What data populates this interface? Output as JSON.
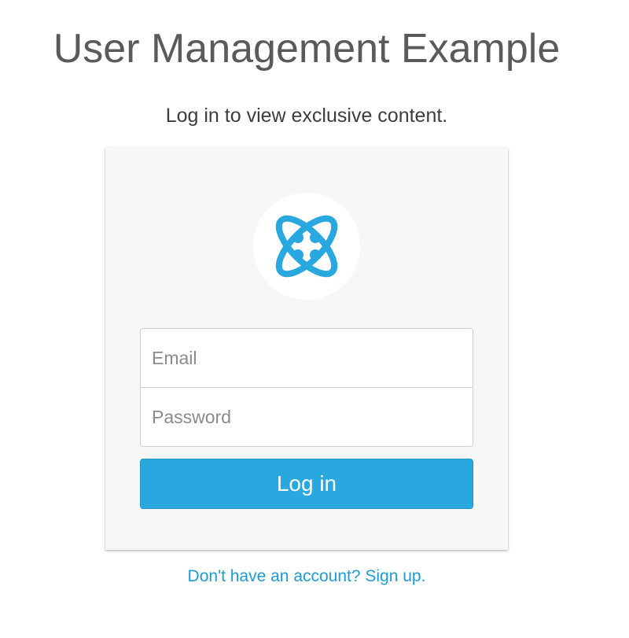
{
  "header": {
    "title": "User Management Example",
    "subtitle": "Log in to view exclusive content."
  },
  "login_form": {
    "logo_icon": "atom-logo-icon",
    "email_placeholder": "Email",
    "password_placeholder": "Password",
    "submit_label": "Log in"
  },
  "footer": {
    "signup_link": "Don't have an account? Sign up."
  },
  "colors": {
    "accent": "#29a8e0",
    "link": "#1e9bd7",
    "card_background": "#f7f7f7"
  }
}
